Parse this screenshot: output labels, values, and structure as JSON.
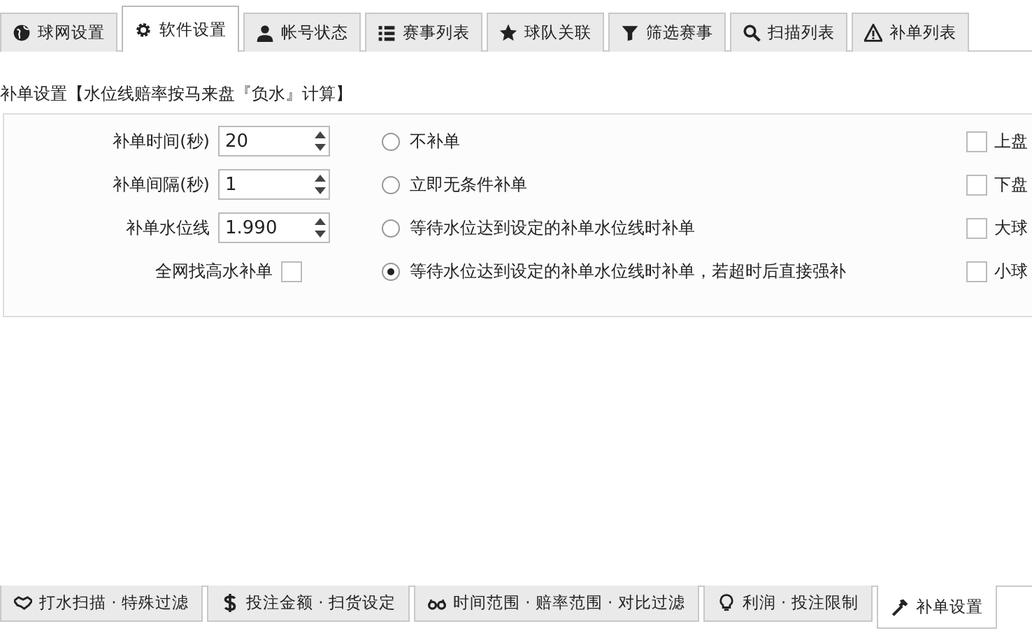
{
  "top_tabs": [
    {
      "label": "球网设置",
      "selected": false
    },
    {
      "label": "软件设置",
      "selected": true
    },
    {
      "label": "帐号状态",
      "selected": false
    },
    {
      "label": "赛事列表",
      "selected": false
    },
    {
      "label": "球队关联",
      "selected": false
    },
    {
      "label": "筛选赛事",
      "selected": false
    },
    {
      "label": "扫描列表",
      "selected": false
    },
    {
      "label": "补单列表",
      "selected": false
    }
  ],
  "section_title": "补单设置【水位线赔率按马来盘『负水』计算】",
  "fields": [
    {
      "label": "补单时间(秒)",
      "value": "20"
    },
    {
      "label": "补单间隔(秒)",
      "value": "1"
    },
    {
      "label": "补单水位线",
      "value": "1.990"
    }
  ],
  "high_water": {
    "label": "全网找高水补单",
    "checked": false
  },
  "modes": [
    {
      "label": "不补单",
      "selected": false
    },
    {
      "label": "立即无条件补单",
      "selected": false
    },
    {
      "label": "等待水位达到设定的补单水位线时补单",
      "selected": false
    },
    {
      "label": "等待水位达到设定的补单水位线时补单，若超时后直接强补",
      "selected": true
    }
  ],
  "bet_types": [
    {
      "label": "上盘",
      "checked": false
    },
    {
      "label": "下盘",
      "checked": false
    },
    {
      "label": "大球",
      "checked": false
    },
    {
      "label": "小球",
      "checked": false
    }
  ],
  "bottom_tabs": [
    {
      "label": "打水扫描 · 特殊过滤",
      "selected": false
    },
    {
      "label": "投注金额 · 扫货设定",
      "selected": false
    },
    {
      "label": "时间范围 · 赔率范围 · 对比过滤",
      "selected": false
    },
    {
      "label": "利润 · 投注限制",
      "selected": false
    },
    {
      "label": "补单设置",
      "selected": true
    }
  ]
}
